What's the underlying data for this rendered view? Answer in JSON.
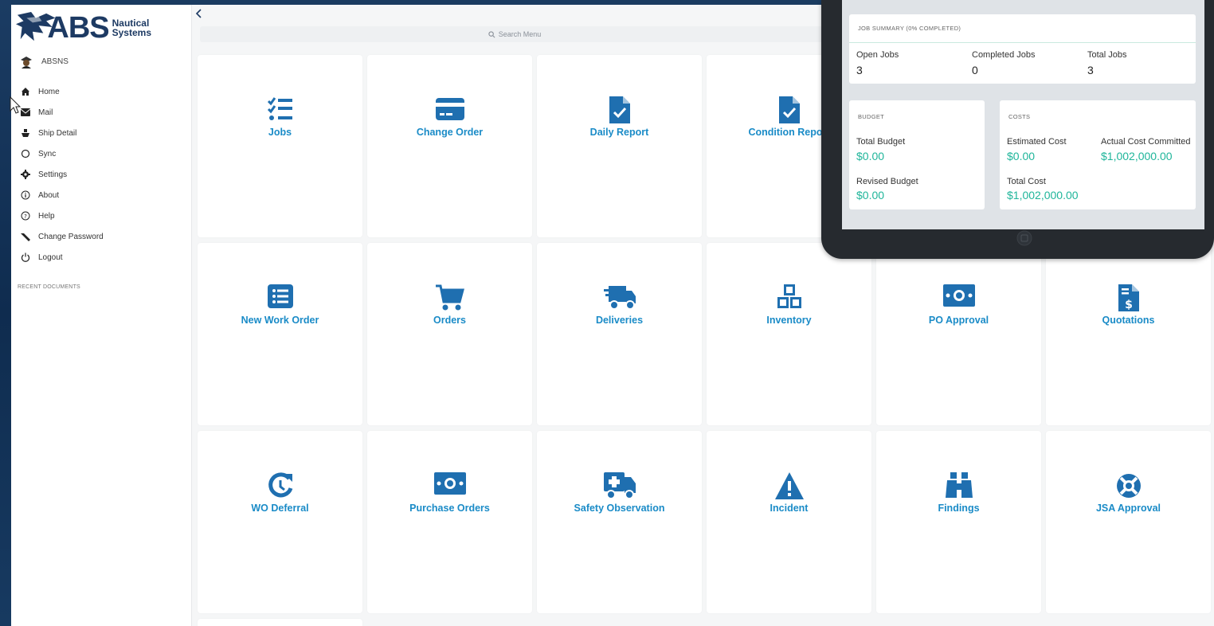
{
  "app": {
    "logo_text": "ABS",
    "logo_sub1": "Nautical",
    "logo_sub2": "Systems",
    "user_name": "ABSNS",
    "search_placeholder": "Search Menu",
    "recent_documents": "RECENT DOCUMENTS"
  },
  "sidebar": {
    "items": [
      {
        "label": "Home",
        "icon": "home-icon"
      },
      {
        "label": "Mail",
        "icon": "mail-icon"
      },
      {
        "label": "Ship Detail",
        "icon": "ship-icon"
      },
      {
        "label": "Sync",
        "icon": "sync-icon"
      },
      {
        "label": "Settings",
        "icon": "gear-icon"
      },
      {
        "label": "About",
        "icon": "info-icon"
      },
      {
        "label": "Help",
        "icon": "help-icon"
      },
      {
        "label": "Change Password",
        "icon": "key-icon"
      },
      {
        "label": "Logout",
        "icon": "power-icon"
      }
    ]
  },
  "tiles": [
    {
      "label": "Jobs",
      "icon": "checklist-icon"
    },
    {
      "label": "Change Order",
      "icon": "card-icon"
    },
    {
      "label": "Daily Report",
      "icon": "file-check-icon"
    },
    {
      "label": "Condition Report",
      "icon": "file-check-icon"
    },
    {
      "label": "New Work Order",
      "icon": "list-box-icon"
    },
    {
      "label": "Orders",
      "icon": "cart-icon"
    },
    {
      "label": "Deliveries",
      "icon": "truck-icon"
    },
    {
      "label": "Inventory",
      "icon": "boxes-icon"
    },
    {
      "label": "PO Approval",
      "icon": "money-icon"
    },
    {
      "label": "Quotations",
      "icon": "invoice-icon"
    },
    {
      "label": "WO Deferral",
      "icon": "history-icon"
    },
    {
      "label": "Purchase Orders",
      "icon": "money-icon"
    },
    {
      "label": "Safety Observation",
      "icon": "ambulance-icon"
    },
    {
      "label": "Incident",
      "icon": "warning-icon"
    },
    {
      "label": "Findings",
      "icon": "binoculars-icon"
    },
    {
      "label": "JSA Approval",
      "icon": "life-ring-icon"
    }
  ],
  "tablet": {
    "job_summary": {
      "title": "JOB SUMMARY (0% COMPLETED)",
      "open_label": "Open Jobs",
      "open_value": "3",
      "completed_label": "Completed Jobs",
      "completed_value": "0",
      "total_label": "Total Jobs",
      "total_value": "3"
    },
    "budget": {
      "title": "BUDGET",
      "total_label": "Total Budget",
      "total_value": "$0.00",
      "revised_label": "Revised Budget",
      "revised_value": "$0.00"
    },
    "costs": {
      "title": "COSTS",
      "estimated_label": "Estimated Cost",
      "estimated_value": "$0.00",
      "actual_label": "Actual Cost Committed",
      "actual_value": "$1,002,000.00",
      "total_label": "Total Cost",
      "total_value": "$1,002,000.00"
    }
  },
  "colors": {
    "tile_label": "#1a8bc7",
    "tile_icon": "#1f6fb0",
    "money": "#1fb59a",
    "brand": "#1d3a63"
  }
}
